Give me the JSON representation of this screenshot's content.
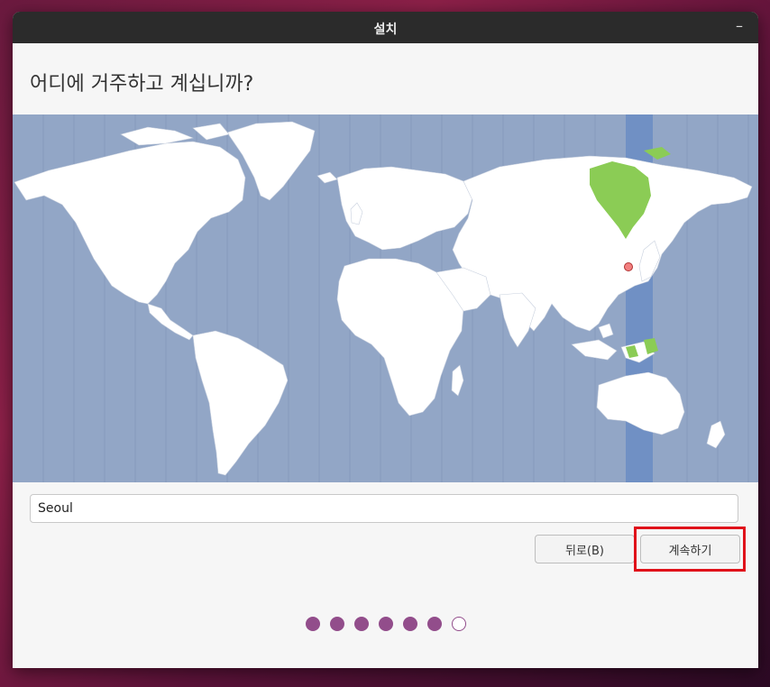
{
  "window": {
    "title": "설치",
    "minimize_icon": "minimize-icon"
  },
  "page": {
    "heading": "어디에 거주하고 계십니까?"
  },
  "map": {
    "selected_city": "Seoul",
    "highlight_color": "#8bcc55",
    "timezone_band_color": "#7090c4",
    "water_color": "#92a6c6"
  },
  "location": {
    "value": "Seoul",
    "placeholder": ""
  },
  "buttons": {
    "back_label": "뒤로(B)",
    "continue_label": "계속하기"
  },
  "progress": {
    "total_steps": 7,
    "completed_steps": 6,
    "accent": "#924d8b"
  }
}
